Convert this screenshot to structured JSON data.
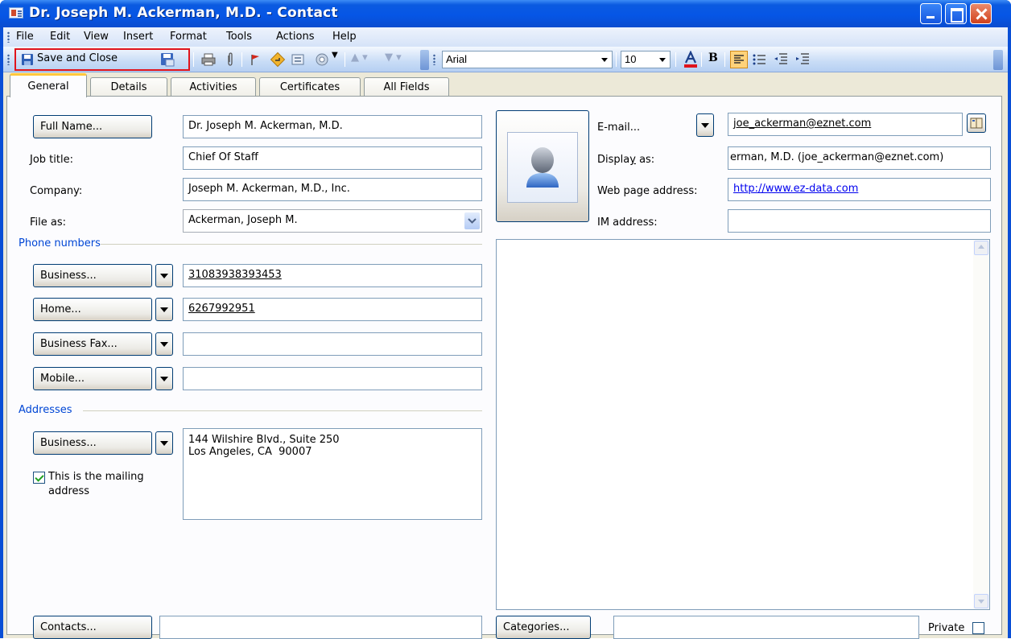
{
  "window": {
    "title": "Dr. Joseph M. Ackerman, M.D. - Contact"
  },
  "menu": [
    "File",
    "Edit",
    "View",
    "Insert",
    "Format",
    "Tools",
    "Actions",
    "Help"
  ],
  "toolbar": {
    "save_close": "Save and Close",
    "font": "Arial",
    "size": "10",
    "bold": "B"
  },
  "tabs": [
    "General",
    "Details",
    "Activities",
    "Certificates",
    "All Fields"
  ],
  "name_fields": {
    "full_name_btn": "Full Name...",
    "full_name": "Dr. Joseph M. Ackerman, M.D.",
    "job_title_lbl": "Job title:",
    "job_title": "Chief Of Staff",
    "company_lbl": "Company:",
    "company": "Joseph M. Ackerman, M.D., Inc.",
    "file_as_lbl": "File as:",
    "file_as": "Ackerman, Joseph M."
  },
  "phones": {
    "section": "Phone numbers",
    "business_btn": "Business...",
    "business": "31083938393453",
    "home_btn": "Home...",
    "home": "6267992951",
    "fax_btn": "Business Fax...",
    "fax": "",
    "mobile_btn": "Mobile...",
    "mobile": ""
  },
  "addresses": {
    "section": "Addresses",
    "business_btn": "Business...",
    "line1": "144 Wilshire Blvd., Suite 250",
    "line2": "Los Angeles, CA  90007",
    "mailing_line1": "This is the mailing",
    "mailing_line2": "address",
    "mailing_checked": true
  },
  "internet": {
    "email_lbl": "E-mail...",
    "email": "joe_ackerman@eznet.com",
    "display_lbl": "Display as:",
    "display": "erman, M.D. (joe_ackerman@eznet.com)",
    "web_lbl": "Web page address:",
    "web": "http://www.ez-data.com",
    "im_lbl": "IM address:",
    "im": ""
  },
  "bottom": {
    "contacts_btn": "Contacts...",
    "contacts": "",
    "categories_btn": "Categories...",
    "categories": "",
    "private_lbl": "Private",
    "private_checked": false
  },
  "colors": {
    "title_bar": "#0656e6",
    "section": "#0046d5",
    "highlight": "#e0141c",
    "tab_accent": "#ffc83c"
  }
}
